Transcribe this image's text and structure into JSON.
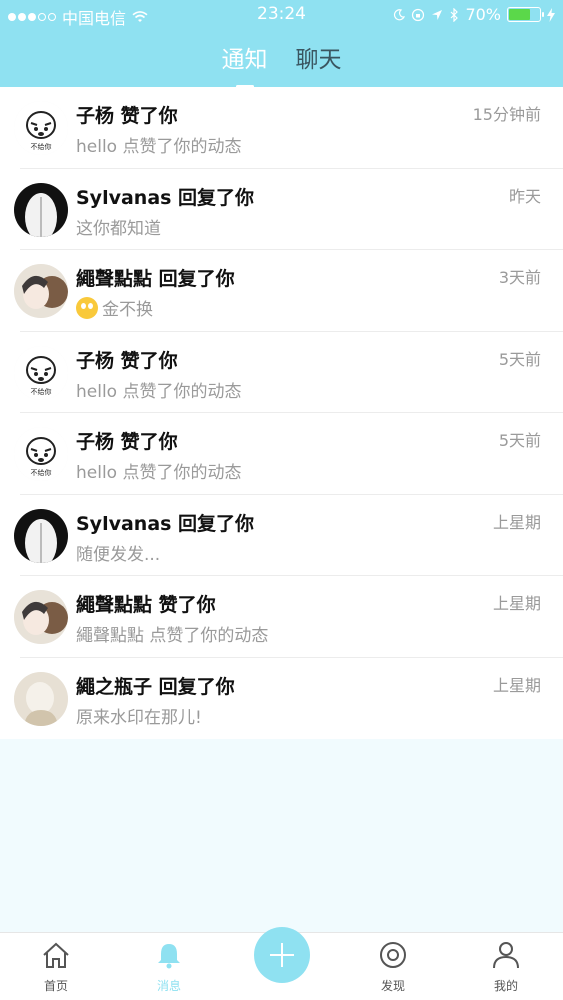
{
  "status_bar": {
    "carrier": "中国电信",
    "time": "23:24",
    "battery": "70%",
    "signal_bars": 3,
    "signal_total": 5,
    "battery_level": 0.7
  },
  "tabs": [
    {
      "label": "通知",
      "active": true
    },
    {
      "label": "聊天",
      "active": false
    }
  ],
  "notifications": [
    {
      "title": "子杨 赞了你",
      "subtitle": "hello 点赞了你的动态",
      "time": "15分钟前",
      "avatar": "meme"
    },
    {
      "title": "Sylvanas 回复了你",
      "subtitle": "这你都知道",
      "time": "昨天",
      "avatar": "bw"
    },
    {
      "title": "繩聲點點 回复了你",
      "subtitle": "金不换",
      "time": "3天前",
      "avatar": "girl",
      "emoji": true
    },
    {
      "title": "子杨 赞了你",
      "subtitle": "hello 点赞了你的动态",
      "time": "5天前",
      "avatar": "meme"
    },
    {
      "title": "子杨 赞了你",
      "subtitle": "hello 点赞了你的动态",
      "time": "5天前",
      "avatar": "meme"
    },
    {
      "title": "Sylvanas 回复了你",
      "subtitle": "随便发发...",
      "time": "上星期",
      "avatar": "bw"
    },
    {
      "title": "繩聲點點 赞了你",
      "subtitle": "繩聲點點 点赞了你的动态",
      "time": "上星期",
      "avatar": "girl"
    },
    {
      "title": "繩之瓶子 回复了你",
      "subtitle": "原来水印在那儿!",
      "time": "上星期",
      "avatar": "beige"
    }
  ],
  "meme_avatar_text": "不给你",
  "bottom_nav": [
    {
      "label": "首页",
      "icon": "home-icon",
      "active": false
    },
    {
      "label": "消息",
      "icon": "bell-icon",
      "active": true
    },
    {
      "label": "发现",
      "icon": "discover-icon",
      "active": false
    },
    {
      "label": "我的",
      "icon": "person-icon",
      "active": false
    }
  ],
  "colors": {
    "accent": "#8fe1f1",
    "background": "#f1fbfe",
    "title_text": "#111111",
    "secondary_text": "#9a9a9a"
  }
}
